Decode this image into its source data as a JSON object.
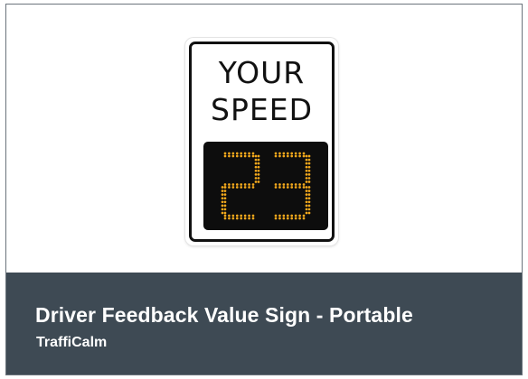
{
  "product": {
    "title": "Driver Feedback Value Sign - Portable",
    "brand": "TraffiCalm"
  },
  "sign": {
    "line1": "YOUR",
    "line2": "SPEED",
    "speed_value": "23",
    "led_color": "#f2a81c"
  },
  "colors": {
    "footer_bg": "#3e4a54",
    "card_border": "#6b747c"
  }
}
